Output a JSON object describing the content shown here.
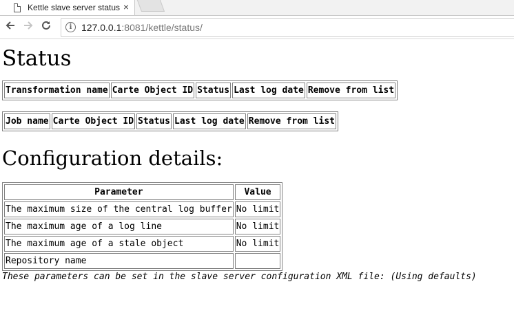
{
  "browser": {
    "tab_title": "Kettle slave server status",
    "tab_close": "×",
    "url_host": "127.0.0.1",
    "url_rest": ":8081/kettle/status/",
    "icons": {
      "back": "arrow-left",
      "forward": "arrow-right",
      "reload": "reload",
      "info": "info"
    }
  },
  "page": {
    "title": "Status",
    "transformations_table": {
      "headers": [
        "Transformation name",
        "Carte Object ID",
        "Status",
        "Last log date",
        "Remove from list"
      ]
    },
    "jobs_table": {
      "headers": [
        "Job name",
        "Carte Object ID",
        "Status",
        "Last log date",
        "Remove from list"
      ]
    },
    "config_title": "Configuration details:",
    "config_table": {
      "headers": [
        "Parameter",
        "Value"
      ],
      "rows": [
        [
          "The maximum size of the central log buffer",
          "No limit"
        ],
        [
          "The maximum age of a log line",
          "No limit"
        ],
        [
          "The maximum age of a stale object",
          "No limit"
        ],
        [
          "Repository name",
          ""
        ]
      ]
    },
    "note": "These parameters can be set in the slave server configuration XML file: (Using defaults)"
  }
}
